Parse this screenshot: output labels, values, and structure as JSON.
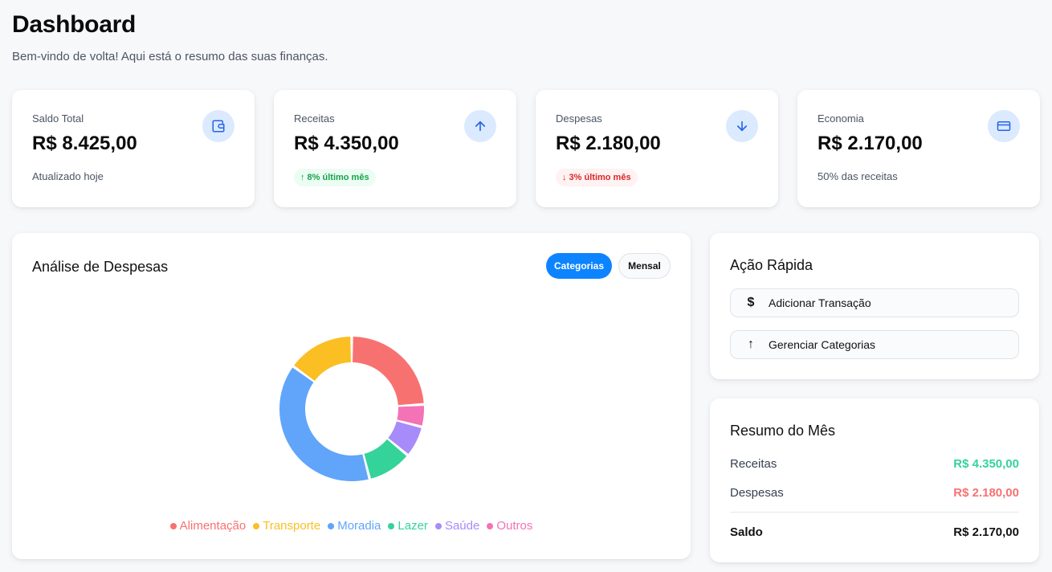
{
  "header": {
    "title": "Dashboard",
    "subtitle": "Bem-vindo de volta! Aqui está o resumo das suas finanças."
  },
  "stats": [
    {
      "label": "Saldo Total",
      "value": "R$ 8.425,00",
      "note": "Atualizado hoje",
      "icon": "wallet-icon"
    },
    {
      "label": "Receitas",
      "value": "R$ 4.350,00",
      "badge": "↑ 8% último mês",
      "icon": "arrow-up-icon"
    },
    {
      "label": "Despesas",
      "value": "R$ 2.180,00",
      "badge": "↓ 3% último mês",
      "icon": "arrow-down-icon"
    },
    {
      "label": "Economia",
      "value": "R$ 2.170,00",
      "note": "50% das receitas",
      "icon": "credit-card-icon"
    }
  ],
  "chart": {
    "title": "Análise de Despesas",
    "toggle": {
      "active": "Categorias",
      "other": "Mensal"
    }
  },
  "chart_data": {
    "type": "pie",
    "donut": true,
    "title": "",
    "categories": [
      "Alimentação",
      "Transporte",
      "Moradia",
      "Lazer",
      "Saúde",
      "Outros"
    ],
    "order_clockwise_from_top": [
      "Alimentação",
      "Outros",
      "Saúde",
      "Lazer",
      "Moradia",
      "Transporte"
    ],
    "values": {
      "Alimentação": 24,
      "Outros": 5,
      "Saúde": 7,
      "Lazer": 10,
      "Moradia": 39,
      "Transporte": 15
    },
    "colors": {
      "Alimentação": "#f87171",
      "Transporte": "#fbbf24",
      "Moradia": "#60a5fa",
      "Lazer": "#34d399",
      "Saúde": "#a78bfa",
      "Outros": "#f472b6"
    },
    "legend": "bottom"
  },
  "quick": {
    "title": "Ação Rápida",
    "buttons": [
      {
        "label": "Adicionar Transação",
        "icon": "dollar-icon",
        "glyph": "$"
      },
      {
        "label": "Gerenciar Categorias",
        "icon": "arrow-up-icon",
        "glyph": "↑"
      }
    ]
  },
  "summary": {
    "title": "Resumo do Mês",
    "rows": [
      {
        "label": "Receitas",
        "value": "R$ 4.350,00",
        "color": "#34d399"
      },
      {
        "label": "Despesas",
        "value": "R$ 2.180,00",
        "color": "#f87171"
      }
    ],
    "total": {
      "label": "Saldo",
      "value": "R$ 2.170,00"
    }
  },
  "colors": {
    "accent": "#0d84ff",
    "icon_bg": "#dbeafe",
    "icon_fg": "#2563eb"
  }
}
